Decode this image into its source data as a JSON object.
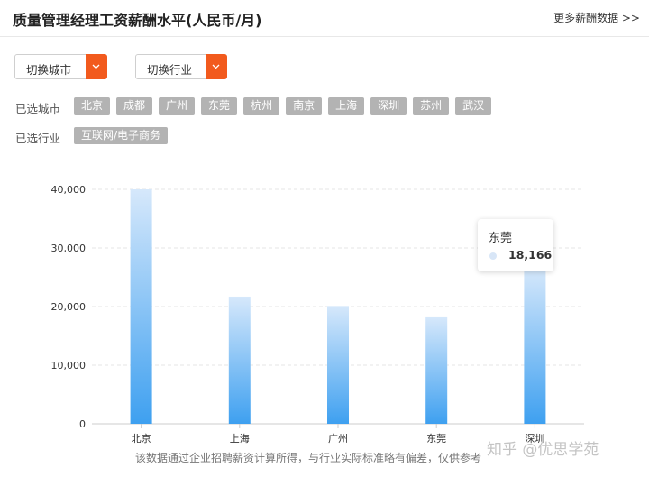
{
  "header": {
    "title": "质量管理经理工资薪酬水平(人民币/月)",
    "more_link": "更多薪酬数据 >>"
  },
  "filters": {
    "city_dropdown": "切换城市",
    "industry_dropdown": "切换行业",
    "selected_cities_label": "已选城市",
    "selected_cities": [
      "北京",
      "成都",
      "广州",
      "东莞",
      "杭州",
      "南京",
      "上海",
      "深圳",
      "苏州",
      "武汉"
    ],
    "selected_industry_label": "已选行业",
    "selected_industries": [
      "互联网/电子商务"
    ]
  },
  "colors": {
    "accent": "#f25a1d",
    "tag_bg": "#b3b3b3",
    "bar_top": "#d6e8fb",
    "bar_bottom": "#3ea0f0"
  },
  "chart_data": {
    "type": "bar",
    "title": "",
    "xlabel": "",
    "ylabel": "",
    "categories": [
      "北京",
      "上海",
      "广州",
      "东莞",
      "深圳"
    ],
    "values": [
      40000,
      21700,
      20100,
      18166,
      26600
    ],
    "ylim": [
      0,
      40000
    ],
    "yticks": [
      0,
      10000,
      20000,
      30000,
      40000
    ],
    "ytick_labels": [
      "0",
      "10,000",
      "20,000",
      "30,000",
      "40,000"
    ],
    "grid": true,
    "gradient": true
  },
  "tooltip": {
    "title": "东莞",
    "value": "18,166"
  },
  "footnote": "该数据通过企业招聘薪资计算所得，与行业实际标准略有偏差，仅供参考",
  "watermark": "知乎 @优思学苑"
}
